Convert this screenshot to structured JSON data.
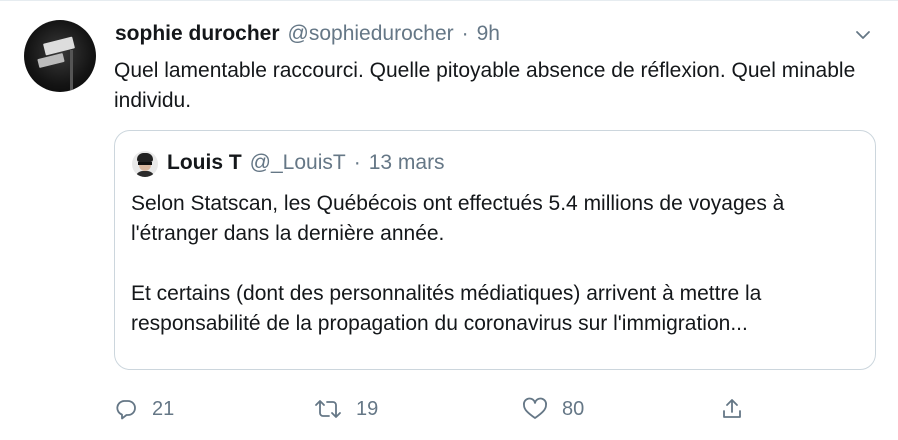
{
  "author": {
    "display_name": "sophie durocher",
    "handle": "@sophiedurocher",
    "separator": "·",
    "time": "9h"
  },
  "tweet_text": "Quel lamentable raccourci.  Quelle pitoyable absence de réflexion. Quel minable individu.",
  "quoted_tweet": {
    "display_name": "Louis T",
    "handle": "@_LouisT",
    "separator": "·",
    "date": "13 mars",
    "paragraphs": [
      "Selon Statscan, les Québécois ont effectués 5.4 millions de voyages à l'étranger dans la dernière année.",
      "Et certains (dont des personnalités médiatiques) arrivent à mettre la responsabilité de la propagation du coronavirus sur l'immigration..."
    ]
  },
  "actions": {
    "reply_count": "21",
    "retweet_count": "19",
    "like_count": "80"
  },
  "icons": {
    "menu": "chevron-down-icon",
    "reply": "reply-icon",
    "retweet": "retweet-icon",
    "like": "heart-icon",
    "share": "share-icon"
  },
  "colors": {
    "text": "#14171a",
    "secondary": "#657786",
    "border": "#ccd6dd"
  }
}
